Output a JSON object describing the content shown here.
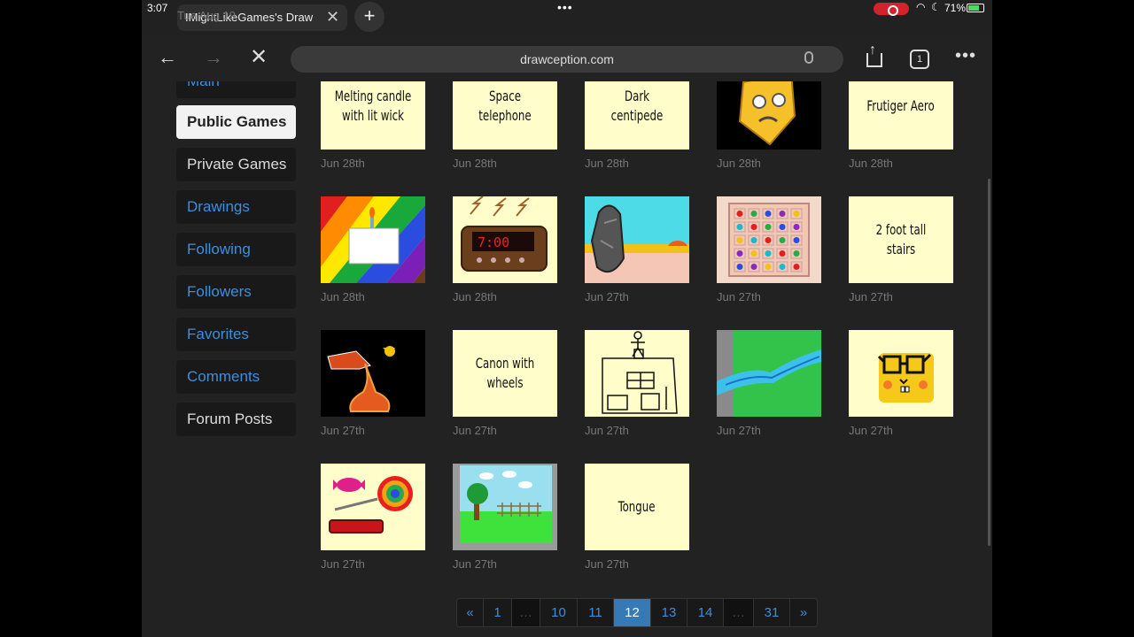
{
  "status": {
    "time": "3:07",
    "date": "Tue Aug 19",
    "battery": "71%"
  },
  "tab": {
    "title": "IMightLikeGames's Draw"
  },
  "toolbar": {
    "url": "drawception.com",
    "tab_count": "1"
  },
  "sidebar": {
    "items": [
      {
        "label": "Main"
      },
      {
        "label": "Public Games"
      },
      {
        "label": "Private Games"
      },
      {
        "label": "Drawings"
      },
      {
        "label": "Following"
      },
      {
        "label": "Followers"
      },
      {
        "label": "Favorites"
      },
      {
        "label": "Comments"
      },
      {
        "label": "Forum Posts"
      }
    ]
  },
  "games": [
    {
      "caption": "Melting candle with lit wick",
      "date": "Jun 28th"
    },
    {
      "caption": "Space telephone",
      "date": "Jun 28th"
    },
    {
      "caption": "Dark centipede",
      "date": "Jun 28th"
    },
    {
      "caption": "",
      "drawing": "cheese-face",
      "date": "Jun 28th"
    },
    {
      "caption": "Frutiger Aero",
      "date": "Jun 28th"
    },
    {
      "caption": "",
      "drawing": "rainbow-cake",
      "date": "Jun 28th"
    },
    {
      "caption": "",
      "drawing": "alarm-clock",
      "date": "Jun 28th"
    },
    {
      "caption": "",
      "drawing": "beach-rock",
      "date": "Jun 27th"
    },
    {
      "caption": "",
      "drawing": "bead-board",
      "date": "Jun 27th"
    },
    {
      "caption": "2 foot tall stairs",
      "date": "Jun 27th"
    },
    {
      "caption": "",
      "drawing": "pouring-bottle",
      "date": "Jun 27th"
    },
    {
      "caption": "Canon with wheels",
      "date": "Jun 27th"
    },
    {
      "caption": "",
      "drawing": "house-figure",
      "date": "Jun 27th"
    },
    {
      "caption": "",
      "drawing": "river-grass",
      "date": "Jun 27th"
    },
    {
      "caption": "",
      "drawing": "glasses-sponge",
      "date": "Jun 27th"
    },
    {
      "caption": "",
      "drawing": "candy-lollipop",
      "date": "Jun 27th"
    },
    {
      "caption": "",
      "drawing": "park-tree",
      "date": "Jun 27th"
    },
    {
      "caption": "Tongue",
      "date": "Jun 27th"
    }
  ],
  "pagination": [
    "«",
    "1",
    "…",
    "10",
    "11",
    "12",
    "13",
    "14",
    "…",
    "31",
    "»"
  ],
  "pagination_current": "12"
}
